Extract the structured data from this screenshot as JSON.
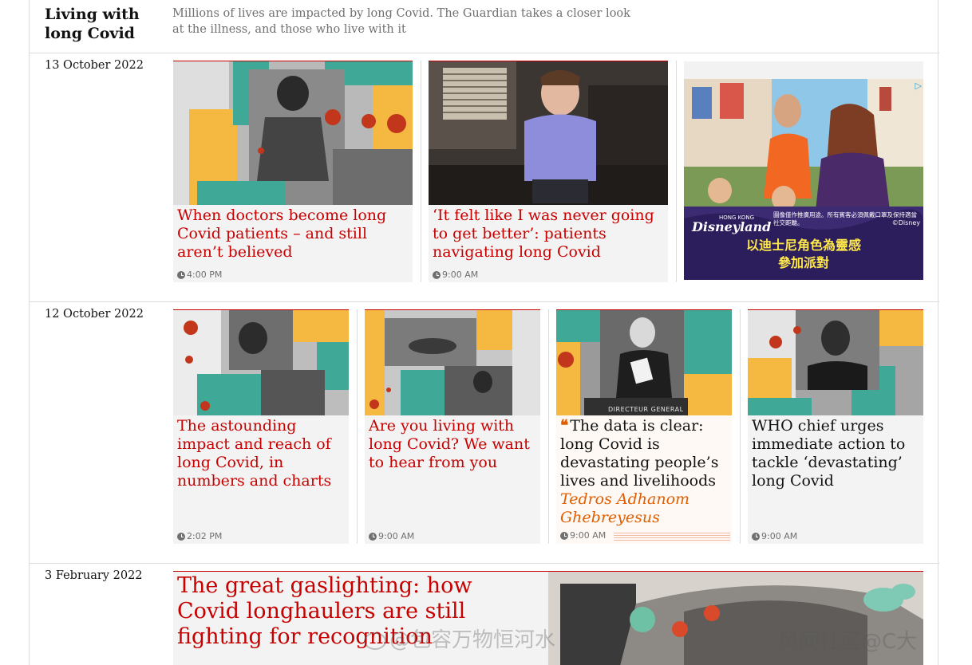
{
  "section": {
    "title": "Living with long Covid",
    "description": "Millions of lives are impacted by long Covid. The Guardian takes a closer look at the illness, and those who live with it"
  },
  "rows": [
    {
      "date": "13 October 2022",
      "cards": [
        {
          "headline": "When doctors become long Covid patients – and still aren’t believed",
          "time": "4:00 PM"
        },
        {
          "headline": "‘It felt like I was never going to get better’: patients navigating long Covid",
          "time": "9:00 AM"
        }
      ],
      "ad": {
        "ad_choices_icon": "ad-choices-icon",
        "logo": "Disneyland",
        "logo_small": "HONG KONG",
        "fine_print": "圖像僅作推廣用途。所有賓客必須佩戴口罩及保持適當社交距離。",
        "copyright": "©Disney",
        "tagline": "以迪士尼角色為靈感\n參加派對"
      }
    },
    {
      "date": "12 October 2022",
      "cards": [
        {
          "headline": "The astounding impact and reach of long Covid, in numbers and charts",
          "time": "2:02 PM"
        },
        {
          "headline": "Are you living with long Covid? We want to hear from you",
          "time": "9:00 AM"
        },
        {
          "headline": "The data is clear: long Covid is devastating people’s lives and livelihoods",
          "byline": "Tedros Adhanom Ghebreyesus",
          "time": "9:00 AM",
          "image_caption": "DIRECTEUR GENERAL"
        },
        {
          "headline": "WHO chief urges immediate action to tackle ‘devastating’ long Covid",
          "time": "9:00 AM"
        }
      ]
    },
    {
      "date": "3 February 2022",
      "feature": {
        "headline": "The great gaslighting: how Covid longhaulers are still fighting for recognition"
      }
    }
  ],
  "watermarks": [
    "@包容万物恒河水",
    "风闻社区@C大"
  ],
  "colors": {
    "news_red": "#c70000",
    "opinion_orange": "#e05e00",
    "teal": "#3fa896",
    "yellow": "#f5b942",
    "card_bg": "#f3f3f3"
  },
  "icons": {
    "clock": "clock-icon",
    "quote": "quote-icon",
    "weibo": "weibo-icon"
  }
}
